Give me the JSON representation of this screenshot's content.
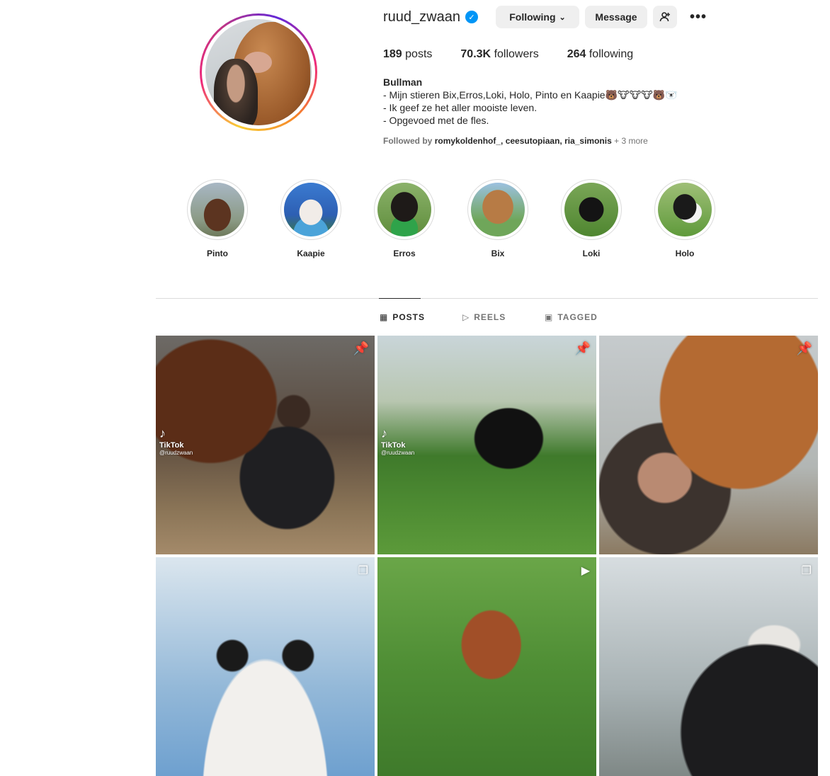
{
  "profile": {
    "username": "ruud_zwaan",
    "verified_icon": "verified-badge-icon",
    "buttons": {
      "following": "Following",
      "message": "Message"
    },
    "stats": {
      "posts_count": "189",
      "posts_label": "posts",
      "followers_count": "70.3K",
      "followers_label": "followers",
      "following_count": "264",
      "following_label": "following"
    },
    "bio": {
      "name": "Bullman",
      "lines": [
        "- Mijn stieren Bix,Erros,Loki, Holo, Pinto en Kaapie🐻🐮🐮🐮🐻🐻‍❄️",
        "- Ik geef ze het aller mooiste leven.",
        "- Opgevoed met de fles."
      ]
    },
    "followed_by": {
      "prefix": "Followed by",
      "names": "romykoldenhof_, ceesutopiaan, ria_simonis",
      "more": "+ 3 more"
    }
  },
  "highlights": [
    {
      "label": "Pinto"
    },
    {
      "label": "Kaapie"
    },
    {
      "label": "Erros"
    },
    {
      "label": "Bix"
    },
    {
      "label": "Loki"
    },
    {
      "label": "Holo"
    }
  ],
  "tabs": {
    "posts": "POSTS",
    "reels": "REELS",
    "tagged": "TAGGED",
    "active": "posts"
  },
  "posts": [
    {
      "pinned": true,
      "overlay": {
        "brand": "TikTok",
        "handle": "@ruudzwaan"
      }
    },
    {
      "pinned": true,
      "overlay": {
        "brand": "TikTok",
        "handle": "@ruudzwaan"
      }
    },
    {
      "pinned": true
    },
    {
      "type_icon": "carousel-icon"
    },
    {
      "type_icon": "reel-icon"
    },
    {
      "type_icon": "carousel-icon"
    }
  ]
}
